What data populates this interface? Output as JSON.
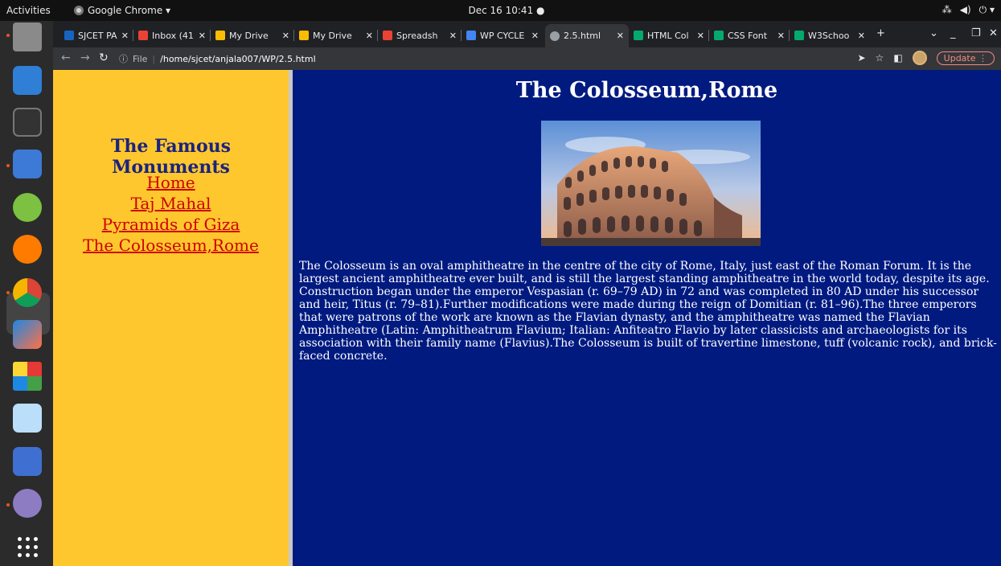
{
  "topbar": {
    "activities": "Activities",
    "app_name": "Google Chrome ▾",
    "clock": "Dec 16  10:41  ●"
  },
  "browser": {
    "tabs": [
      {
        "label": "SJCET PA",
        "color": "#1565c0"
      },
      {
        "label": "Inbox (41",
        "color": "#ea4335"
      },
      {
        "label": "My Drive",
        "color": "#fbbc04"
      },
      {
        "label": "My Drive",
        "color": "#fbbc04"
      },
      {
        "label": "Spreadsh",
        "color": "#ea4335"
      },
      {
        "label": "WP CYCLE",
        "color": "#4285f4"
      },
      {
        "label": "2.5.html",
        "color": "#9aa0a6"
      },
      {
        "label": "HTML Col",
        "color": "#04aa6d"
      },
      {
        "label": "CSS Font",
        "color": "#04aa6d"
      },
      {
        "label": "W3Schoo",
        "color": "#04aa6d"
      }
    ],
    "file_label": "File",
    "url": "/home/sjcet/anjala007/WP/2.5.html",
    "update_label": "Update"
  },
  "page": {
    "sidebar_title": "The Famous Monuments",
    "nav_links": [
      "Home",
      "Taj Mahal",
      "Pyramids of Giza",
      "The Colosseum,Rome"
    ],
    "main_title": "The Colosseum,Rome",
    "description": "The Colosseum is an oval amphitheatre in the centre of the city of Rome, Italy, just east of the Roman Forum. It is the largest ancient amphitheatre ever built, and is still the largest standing amphitheatre in the world today, despite its age. Construction began under the emperor Vespasian (r. 69–79 AD) in 72 and was completed in 80 AD under his successor and heir, Titus (r. 79–81).Further modifications were made during the reign of Domitian (r. 81–96).The three emperors that were patrons of the work are known as the Flavian dynasty, and the amphitheatre was named the Flavian Amphitheatre (Latin: Amphitheatrum Flavium; Italian: Anfiteatro Flavio by later classicists and archaeologists for its association with their family name (Flavius).The Colosseum is built of travertine limestone, tuff (volcanic rock), and brick-faced concrete."
  },
  "colors": {
    "left_frame_bg": "#ffc72e",
    "right_frame_bg": "#001a80",
    "link_color": "#cc0000",
    "sidebar_title_color": "#1a237e"
  }
}
